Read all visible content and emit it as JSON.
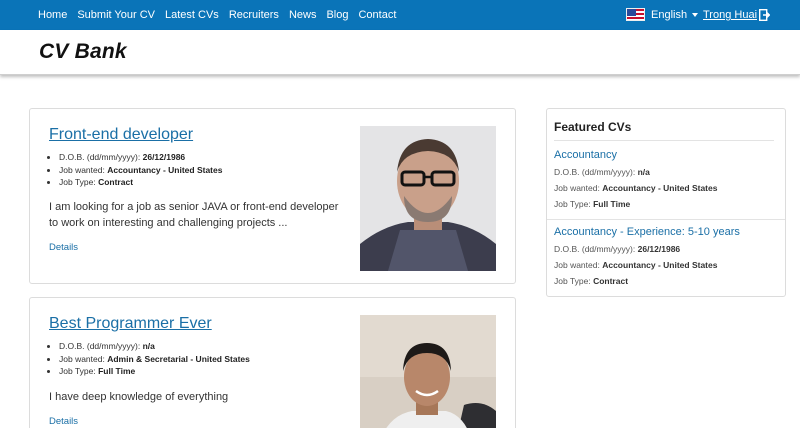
{
  "nav": {
    "items": [
      "Home",
      "Submit Your CV",
      "Latest CVs",
      "Recruiters",
      "News",
      "Blog",
      "Contact"
    ],
    "language": "English",
    "language_icon": "us-flag-icon",
    "user": "Trong Huai",
    "logout_icon": "logout-icon",
    "bar_color": "#0a74b8"
  },
  "brand": {
    "title": "CV Bank"
  },
  "cards": [
    {
      "title": "Front-end developer",
      "dob_label": "D.O.B. (dd/mm/yyyy):",
      "dob": "26/12/1986",
      "job_label": "Job wanted:",
      "job": "Accountancy - United States",
      "type_label": "Job Type:",
      "type": "Contract",
      "description": "I am looking for a job as senior JAVA or front-end developer to work on interesting and challenging projects ...",
      "details": "Details",
      "photo_icon": "man-with-glasses-photo"
    },
    {
      "title": "Best Programmer Ever",
      "dob_label": "D.O.B. (dd/mm/yyyy):",
      "dob": "n/a",
      "job_label": "Job wanted:",
      "job": "Admin & Secretarial - United States",
      "type_label": "Job Type:",
      "type": "Full Time",
      "description": "I have deep knowledge of everything",
      "details": "Details",
      "photo_icon": "smiling-man-photo"
    }
  ],
  "featured": {
    "title": "Featured CVs",
    "items": [
      {
        "title": "Accountancy",
        "dob_label": "D.O.B. (dd/mm/yyyy):",
        "dob": "n/a",
        "job_label": "Job wanted:",
        "job": "Accountancy - United States",
        "type_label": "Job Type:",
        "type": "Full Time"
      },
      {
        "title": "Accountancy - Experience: 5-10 years",
        "dob_label": "D.O.B. (dd/mm/yyyy):",
        "dob": "26/12/1986",
        "job_label": "Job wanted:",
        "job": "Accountancy - United States",
        "type_label": "Job Type:",
        "type": "Contract"
      }
    ]
  }
}
